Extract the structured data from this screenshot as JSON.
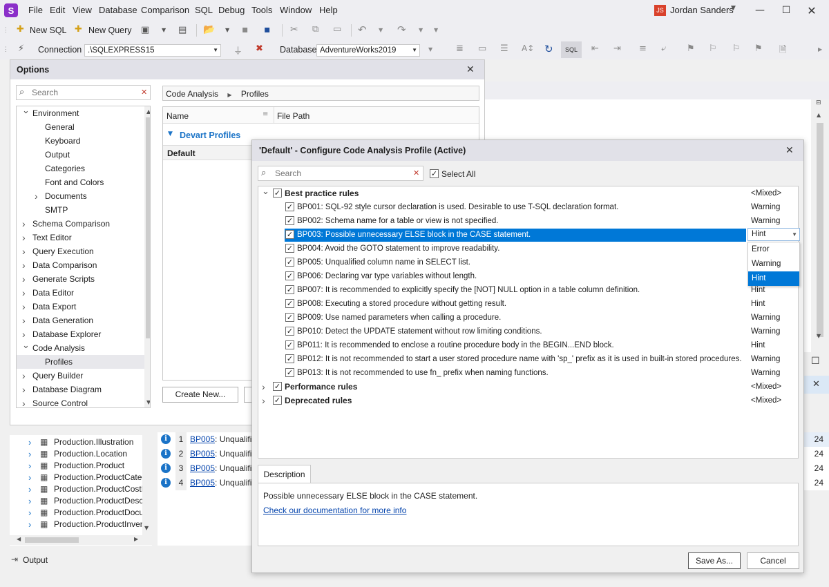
{
  "app": {
    "menus": [
      "File",
      "Edit",
      "View",
      "Database",
      "Comparison",
      "SQL",
      "Debug",
      "Tools",
      "Window",
      "Help"
    ],
    "user_initials": "JS",
    "user_name": "Jordan Sanders"
  },
  "toolbar": {
    "new_sql": "New SQL",
    "new_query": "New Query",
    "connection_label": "Connection",
    "connection_value": ".\\SQLEXPRESS15",
    "database_label": "Database",
    "database_value": "AdventureWorks2019",
    "sql_badge": "SQL"
  },
  "options": {
    "title": "Options",
    "search_placeholder": "Search",
    "tree": [
      {
        "label": "Environment",
        "level": 0,
        "expanded": true
      },
      {
        "label": "General",
        "level": 1
      },
      {
        "label": "Keyboard",
        "level": 1
      },
      {
        "label": "Output",
        "level": 1
      },
      {
        "label": "Categories",
        "level": 1
      },
      {
        "label": "Font and Colors",
        "level": 1
      },
      {
        "label": "Documents",
        "level": 1,
        "collapsed": true
      },
      {
        "label": "SMTP",
        "level": 1
      },
      {
        "label": "Schema Comparison",
        "level": 0,
        "collapsed": true
      },
      {
        "label": "Text Editor",
        "level": 0,
        "collapsed": true
      },
      {
        "label": "Query Execution",
        "level": 0,
        "collapsed": true
      },
      {
        "label": "Data Comparison",
        "level": 0,
        "collapsed": true
      },
      {
        "label": "Generate Scripts",
        "level": 0,
        "collapsed": true
      },
      {
        "label": "Data Editor",
        "level": 0,
        "collapsed": true
      },
      {
        "label": "Data Export",
        "level": 0,
        "collapsed": true
      },
      {
        "label": "Data Generation",
        "level": 0,
        "collapsed": true
      },
      {
        "label": "Database Explorer",
        "level": 0,
        "collapsed": true
      },
      {
        "label": "Code Analysis",
        "level": 0,
        "expanded": true
      },
      {
        "label": "Profiles",
        "level": 1,
        "selected": true
      },
      {
        "label": "Query Builder",
        "level": 0,
        "collapsed": true
      },
      {
        "label": "Database Diagram",
        "level": 0,
        "collapsed": true
      },
      {
        "label": "Source Control",
        "level": 0,
        "collapsed": true
      }
    ],
    "breadcrumb": [
      "Code Analysis",
      "Profiles"
    ],
    "grid_col_name": "Name",
    "grid_col_path": "File Path",
    "group_label": "Devart Profiles",
    "profile_row": "Default",
    "create_new": "Create New..."
  },
  "objects": [
    "Production.Illustration",
    "Production.Location",
    "Production.Product",
    "Production.ProductCatego",
    "Production.ProductCostHis",
    "Production.ProductDescrip",
    "Production.ProductDocume",
    "Production.ProductInvento"
  ],
  "errors": [
    {
      "n": "1",
      "code": "BP005",
      "text": ": Unqualified"
    },
    {
      "n": "2",
      "code": "BP005",
      "text": ": Unqualified"
    },
    {
      "n": "3",
      "code": "BP005",
      "text": ": Unqualified"
    },
    {
      "n": "4",
      "code": "BP005",
      "text": ": Unqualified"
    }
  ],
  "right_nums": [
    "24",
    "24",
    "24",
    "24"
  ],
  "status": {
    "output": "Output"
  },
  "config": {
    "title": "'Default' - Configure Code Analysis Profile (Active)",
    "search_placeholder": "Search",
    "select_all": "Select All",
    "groups": [
      {
        "label": "Best practice rules",
        "severity": "<Mixed>"
      },
      {
        "label": "Performance rules",
        "severity": "<Mixed>"
      },
      {
        "label": "Deprecated rules",
        "severity": "<Mixed>"
      }
    ],
    "rules": [
      {
        "text": "BP001: SQL-92 style cursor declaration is used. Desirable to use T-SQL declaration format.",
        "severity": "Warning"
      },
      {
        "text": "BP002: Schema name for a table or view is not specified.",
        "severity": "Warning"
      },
      {
        "text": "BP003: Possible unnecessary ELSE block in the CASE statement.",
        "severity": "Hint",
        "selected": true
      },
      {
        "text": "BP004: Avoid the GOTO statement to improve readability.",
        "severity": ""
      },
      {
        "text": "BP005: Unqualified column name in SELECT list.",
        "severity": ""
      },
      {
        "text": "BP006: Declaring var type variables without length.",
        "severity": ""
      },
      {
        "text": "BP007: It is recommended to explicitly specify the [NOT] NULL option in a table column definition.",
        "severity": "Hint"
      },
      {
        "text": "BP008: Executing a stored procedure without getting result.",
        "severity": "Hint"
      },
      {
        "text": "BP009: Use named parameters when calling a procedure.",
        "severity": "Warning"
      },
      {
        "text": "BP010: Detect the UPDATE statement without row limiting conditions.",
        "severity": "Warning"
      },
      {
        "text": "BP011: It is recommended to enclose a routine procedure body in the BEGIN...END block.",
        "severity": "Hint"
      },
      {
        "text": "BP012: It is not recommended to start a user stored procedure name with 'sp_' prefix as it is used in built-in stored procedures.",
        "severity": "Warning"
      },
      {
        "text": "BP013: It is not recommended to use fn_ prefix when naming functions.",
        "severity": "Warning"
      }
    ],
    "severity_options": [
      "Error",
      "Warning",
      "Hint"
    ],
    "severity_selected": "Hint",
    "description_tab": "Description",
    "description_text": "Possible unnecessary ELSE block in the CASE statement.",
    "doc_link": "Check our documentation for more info",
    "save_as": "Save As...",
    "cancel": "Cancel"
  }
}
